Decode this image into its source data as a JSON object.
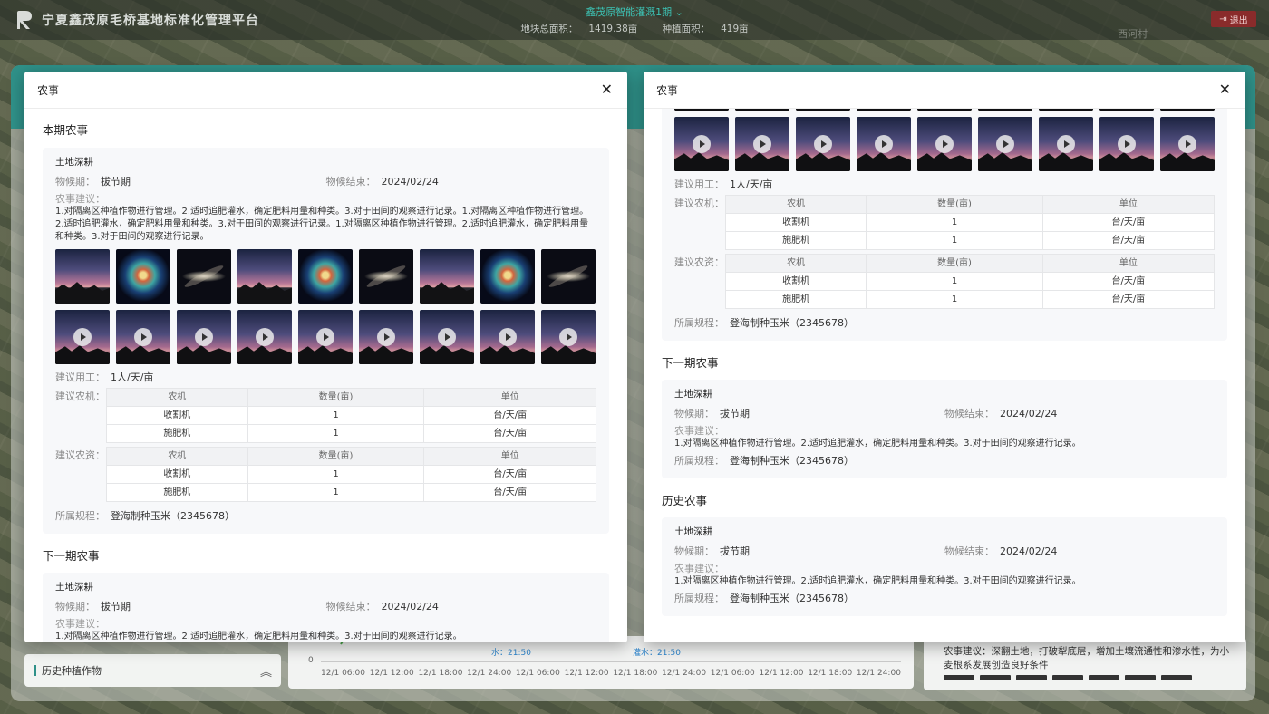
{
  "header": {
    "app_title": "宁夏鑫茂原毛桥基地标准化管理平台",
    "base_name": "鑫茂原智能灌溉1期",
    "total_area_label": "地块总面积：",
    "total_area": "1419.38亩",
    "planting_area_label": "种植面积：",
    "planting_area": "419亩",
    "logout": "退出",
    "village": "西河村"
  },
  "background": {
    "history_crops": "历史种植作物",
    "chart_zero": "0",
    "chart_annotations": [
      "水：21:50",
      "灌水：21:50"
    ],
    "x_ticks": [
      "12/1 06:00",
      "12/1 12:00",
      "12/1 18:00",
      "12/1 24:00",
      "12/1 06:00",
      "12/1 12:00",
      "12/1 18:00",
      "12/1 24:00",
      "12/1 06:00",
      "12/1 12:00",
      "12/1 18:00",
      "12/1 24:00"
    ],
    "right_advice_label": "农事建议：",
    "right_advice": "深翻土地，打破犁底层，增加土壤流通性和渗水性，为小麦根系发展创造良好条件"
  },
  "labels": {
    "modal_title": "农事",
    "current_section": "本期农事",
    "next_section": "下一期农事",
    "history_section": "历史农事",
    "phenology": "物候期：",
    "phenology_end": "物候结束：",
    "advice": "农事建议：",
    "labor": "建议用工：",
    "machines": "建议农机：",
    "materials": "建议农资：",
    "rule": "所属规程："
  },
  "current": {
    "title": "土地深耕",
    "phenology": "拔节期",
    "phenology_end": "2024/02/24",
    "advice": "1.对隔离区种植作物进行管理。2.适时追肥灌水，确定肥料用量和种类。3.对于田间的观察进行记录。1.对隔离区种植作物进行管理。2.适时追肥灌水，确定肥料用量和种类。3.对于田间的观察进行记录。1.对隔离区种植作物进行管理。2.适时追肥灌水，确定肥料用量和种类。3.对于田间的观察进行记录。",
    "labor": "1人/天/亩",
    "rule": "登海制种玉米（2345678）"
  },
  "machines_table": {
    "headers": [
      "农机",
      "数量(亩)",
      "单位"
    ],
    "rows": [
      [
        "收割机",
        "1",
        "台/天/亩"
      ],
      [
        "施肥机",
        "1",
        "台/天/亩"
      ]
    ]
  },
  "materials_table": {
    "headers": [
      "农机",
      "数量(亩)",
      "单位"
    ],
    "rows": [
      [
        "收割机",
        "1",
        "台/天/亩"
      ],
      [
        "施肥机",
        "1",
        "台/天/亩"
      ]
    ]
  },
  "next": {
    "title": "土地深耕",
    "phenology": "拔节期",
    "phenology_end": "2024/02/24",
    "advice": "1.对隔离区种植作物进行管理。2.适时追肥灌水，确定肥料用量和种类。3.对于田间的观察进行记录。",
    "rule": "登海制种玉米（2345678）"
  },
  "history": {
    "title": "土地深耕",
    "phenology": "拔节期",
    "phenology_end": "2024/02/24",
    "advice": "1.对隔离区种植作物进行管理。2.适时追肥灌水，确定肥料用量和种类。3.对于田间的观察进行记录。",
    "rule": "登海制种玉米（2345678）"
  }
}
